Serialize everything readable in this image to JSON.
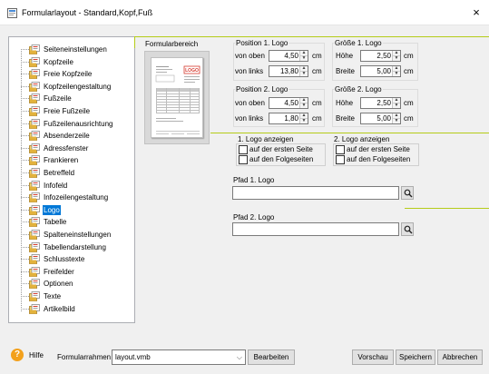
{
  "window": {
    "title": "Formularlayout - Standard,Kopf,Fuß",
    "close_glyph": "×"
  },
  "tree": {
    "items": [
      {
        "label": "Seiteneinstellungen"
      },
      {
        "label": "Kopfzeile"
      },
      {
        "label": "Freie Kopfzeile"
      },
      {
        "label": "Kopfzeilengestaltung"
      },
      {
        "label": "Fußzeile"
      },
      {
        "label": "Freie Fußzeile"
      },
      {
        "label": "Fußzeilenausrichtung"
      },
      {
        "label": "Absenderzeile"
      },
      {
        "label": "Adressfenster"
      },
      {
        "label": "Frankieren"
      },
      {
        "label": "Betreffeld"
      },
      {
        "label": "Infofeld"
      },
      {
        "label": "Infozeilengestaltung"
      },
      {
        "label": "Logo"
      },
      {
        "label": "Tabelle"
      },
      {
        "label": "Spalteneinstellungen"
      },
      {
        "label": "Tabellendarstellung"
      },
      {
        "label": "Schlusstexte"
      },
      {
        "label": "Freifelder"
      },
      {
        "label": "Optionen"
      },
      {
        "label": "Texte"
      },
      {
        "label": "Artikelbild"
      }
    ],
    "selected": "Logo"
  },
  "preview": {
    "label": "Formularbereich",
    "logo_text": "LOGO"
  },
  "pos1": {
    "title": "Position 1. Logo",
    "top_label": "von oben",
    "top_value": "4,50",
    "top_unit": "cm",
    "left_label": "von links",
    "left_value": "13,80",
    "left_unit": "cm"
  },
  "size1": {
    "title": "Größe 1. Logo",
    "height_label": "Höhe",
    "height_value": "2,50",
    "height_unit": "cm",
    "width_label": "Breite",
    "width_value": "5,00",
    "width_unit": "cm"
  },
  "pos2": {
    "title": "Position 2. Logo",
    "top_label": "von oben",
    "top_value": "4,50",
    "top_unit": "cm",
    "left_label": "von links",
    "left_value": "1,80",
    "left_unit": "cm"
  },
  "size2": {
    "title": "Größe 2. Logo",
    "height_label": "Höhe",
    "height_value": "2,50",
    "height_unit": "cm",
    "width_label": "Breite",
    "width_value": "5,00",
    "width_unit": "cm"
  },
  "show1": {
    "title": "1. Logo anzeigen",
    "first_page": "auf der ersten Seite",
    "first_page_checked": false,
    "next_pages": "auf den Folgeseiten",
    "next_pages_checked": false
  },
  "show2": {
    "title": "2. Logo anzeigen",
    "first_page": "auf der ersten Seite",
    "first_page_checked": false,
    "next_pages": "auf den Folgeseiten",
    "next_pages_checked": false
  },
  "path1": {
    "label": "Pfad 1. Logo",
    "value": ""
  },
  "path2": {
    "label": "Pfad 2. Logo",
    "value": ""
  },
  "footer": {
    "help_glyph": "?",
    "help_label": "Hilfe",
    "frame_label": "Formularrahmen",
    "frame_value": "layout.vmb",
    "edit_button": "Bearbeiten",
    "preview_button": "Vorschau",
    "save_button": "Speichern",
    "cancel_button": "Abbrechen"
  },
  "colors": {
    "accent_line": "#b5cc18",
    "selection": "#0078d7",
    "logo_red": "#d63a2f"
  }
}
